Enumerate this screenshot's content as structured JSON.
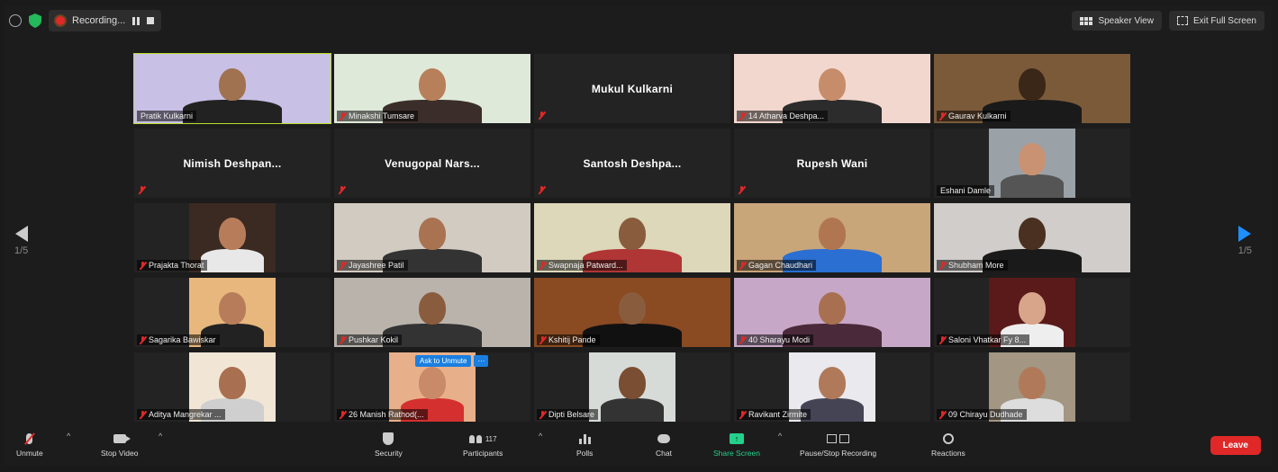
{
  "topbar": {
    "recording_label": "Recording...",
    "speaker_view": "Speaker View",
    "exit_full_screen": "Exit Full Screen"
  },
  "pager": {
    "left": "1/5",
    "right": "1/5"
  },
  "ask_to_unmute": "Ask to Unmute",
  "ask_more": "···",
  "tiles": [
    {
      "name": "Pratik Kulkarni",
      "video": true,
      "muted": false,
      "active": true,
      "bg": "#c9c0e6",
      "skin": "#a0724f",
      "shirt": "#222"
    },
    {
      "name": "Minakshi Tumsare",
      "video": true,
      "muted": true,
      "bg": "#dfe9d9",
      "skin": "#b77f5a",
      "shirt": "#3b2e2a"
    },
    {
      "name": "Mukul Kulkarni",
      "video": false,
      "muted": true
    },
    {
      "name": "14 Atharva Deshpa...",
      "video": true,
      "muted": true,
      "bg": "#f2d7cf",
      "skin": "#c78d6a",
      "shirt": "#2c2c2c"
    },
    {
      "name": "Gaurav Kulkarni",
      "video": true,
      "muted": true,
      "bg": "#7b5a3a",
      "skin": "#3a2718",
      "shirt": "#1a1a1a"
    },
    {
      "name": "Nimish  Deshpan...",
      "video": false,
      "muted": true
    },
    {
      "name": "Venugopal  Nars...",
      "video": false,
      "muted": true
    },
    {
      "name": "Santosh  Deshpa...",
      "video": false,
      "muted": true
    },
    {
      "name": "Rupesh Wani",
      "video": false,
      "muted": true
    },
    {
      "name": "Eshani Damle",
      "video": true,
      "muted": false,
      "center": true,
      "bg": "#9aa2a8",
      "skin": "#c99273",
      "shirt": "#555"
    },
    {
      "name": "Prajakta Thorat",
      "video": true,
      "muted": true,
      "center": true,
      "bg": "#3b2a22",
      "skin": "#b77d5a",
      "shirt": "#e8e8e8"
    },
    {
      "name": "Jayashree Patil",
      "video": true,
      "muted": true,
      "bg": "#d2cbc2",
      "skin": "#a97352",
      "shirt": "#333"
    },
    {
      "name": "Swapnaja Patward...",
      "video": true,
      "muted": true,
      "bg": "#dcd8b9",
      "skin": "#8a5c3e",
      "shirt": "#b03535"
    },
    {
      "name": "Gagan Chaudhari",
      "video": true,
      "muted": true,
      "bg": "#c9a57a",
      "skin": "#b07650",
      "shirt": "#2a6fd1"
    },
    {
      "name": "Shubham More",
      "video": true,
      "muted": true,
      "bg": "#d0cdca",
      "skin": "#4a3020",
      "shirt": "#1a1a1a"
    },
    {
      "name": "Sagarika Bawiskar",
      "video": true,
      "muted": true,
      "center": true,
      "bg": "#e7b77d",
      "skin": "#b77d5a",
      "shirt": "#222"
    },
    {
      "name": "Pushkar Kokil",
      "video": true,
      "muted": true,
      "bg": "#b9b3ab",
      "skin": "#8a5c3e",
      "shirt": "#333"
    },
    {
      "name": "Kshitij Pande",
      "video": true,
      "muted": true,
      "bg": "#8a4a22",
      "skin": "#8a5c3e",
      "shirt": "#111"
    },
    {
      "name": "40 Sharayu Modi",
      "video": true,
      "muted": true,
      "bg": "#c7a7c7",
      "skin": "#a87050",
      "shirt": "#4a2a3a"
    },
    {
      "name": "Saloni Vhatkar Fy 8...",
      "video": true,
      "muted": true,
      "center": true,
      "bg": "#5a1a1a",
      "skin": "#d8a58a",
      "shirt": "#eee"
    },
    {
      "name": "Aditya Mangrekar ...",
      "video": true,
      "muted": true,
      "center": true,
      "bg": "#f1e6d6",
      "skin": "#a87050",
      "shirt": "#cfcfcf"
    },
    {
      "name": "26 Manish Rathod(...",
      "video": true,
      "muted": true,
      "center": true,
      "ask": true,
      "bg": "#e8b08a",
      "skin": "#c98a6a",
      "shirt": "#d53030"
    },
    {
      "name": "Dipti Belsare",
      "video": true,
      "muted": true,
      "center": true,
      "bg": "#d7dbd8",
      "skin": "#7a4e32",
      "shirt": "#333"
    },
    {
      "name": "Ravikant Zirmite",
      "video": true,
      "muted": true,
      "center": true,
      "bg": "#e9e9ee",
      "skin": "#b07a5a",
      "shirt": "#445"
    },
    {
      "name": "09 Chirayu Dudhade",
      "video": true,
      "muted": true,
      "center": true,
      "bg": "#a39682",
      "skin": "#b07a5a",
      "shirt": "#ddd"
    }
  ],
  "controls": {
    "unmute": "Unmute",
    "stop_video": "Stop Video",
    "security": "Security",
    "participants": "Participants",
    "participants_count": "117",
    "polls": "Polls",
    "chat": "Chat",
    "share_screen": "Share Screen",
    "record": "Pause/Stop Recording",
    "reactions": "Reactions",
    "leave": "Leave"
  },
  "colors": {
    "active_speaker": "#b8e02a",
    "leave": "#e02828",
    "share": "#23d18b",
    "nav_next": "#1f8fff"
  }
}
